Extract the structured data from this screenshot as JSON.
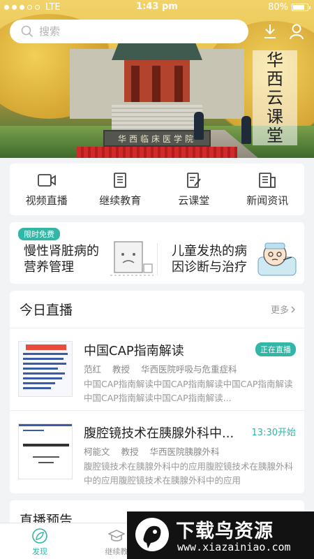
{
  "status_bar": {
    "carrier": "LTE",
    "time": "1:43 pm",
    "battery": "80%",
    "battery_level": 0.8
  },
  "search": {
    "placeholder": "搜索"
  },
  "hero": {
    "banner_text": [
      "华",
      "西",
      "云",
      "课",
      "堂"
    ],
    "stone_text": "华西临床医学院"
  },
  "nav": [
    {
      "label": "视频直播",
      "icon": "video-camera-icon"
    },
    {
      "label": "继续教育",
      "icon": "book-icon"
    },
    {
      "label": "云课堂",
      "icon": "notepad-edit-icon"
    },
    {
      "label": "新闻资讯",
      "icon": "newspaper-icon"
    }
  ],
  "promo": {
    "tag": "限时免费",
    "left_title": "慢性肾脏病的营养管理",
    "right_title": "儿童发热的病因诊断与治疗"
  },
  "live_today": {
    "title": "今日直播",
    "more": "更多",
    "items": [
      {
        "title": "中国CAP指南解读",
        "status": "正在直播",
        "speaker": "范红",
        "rank": "教授",
        "dept": "华西医院呼吸与危重症科",
        "desc": "中国CAP指南解读中国CAP指南解读中国CAP指南解读中国CAP指南解读中国CAP指南解读..."
      },
      {
        "title": "腹腔镜技术在胰腺外科中...",
        "status": "13:30开始",
        "speaker": "柯能文",
        "rank": "教授",
        "dept": "华西医院胰腺外科",
        "desc": "腹腔镜技术在胰腺外科中的应用腹腔镜技术在胰腺外科中的应用腹腔镜技术在胰腺外科中的应用"
      }
    ]
  },
  "preview": {
    "title": "直播预告"
  },
  "tabbar": [
    {
      "label": "发现",
      "active": true
    },
    {
      "label": "继续教"
    }
  ],
  "watermark": {
    "name": "下载鸟资源",
    "url": "www.xiazainiao.com"
  },
  "colors": {
    "accent": "#32b6a6"
  }
}
